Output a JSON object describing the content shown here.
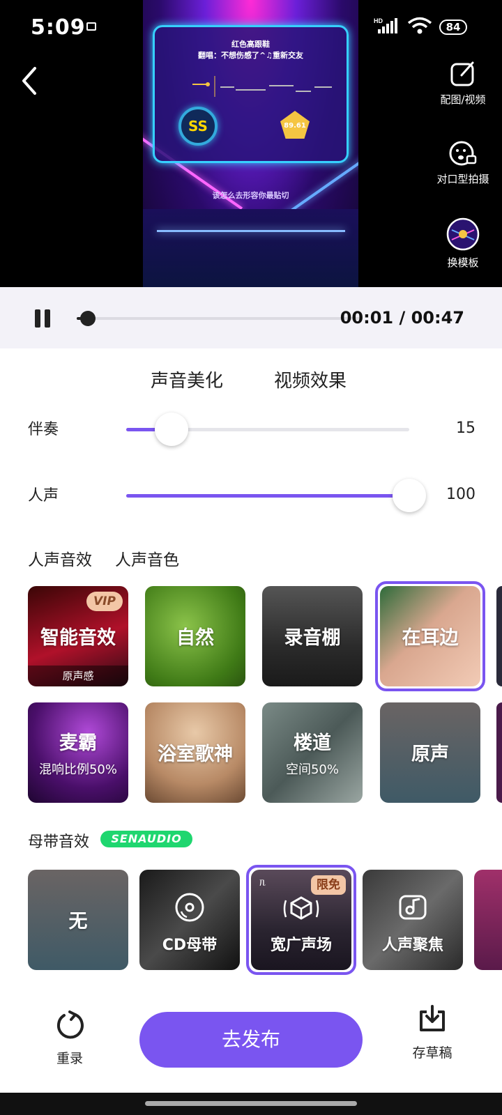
{
  "status": {
    "time": "5:09",
    "network": "HD",
    "battery": "84"
  },
  "video": {
    "song_title": "红色高跟鞋",
    "cover_line": "翻唱：不想伤感了^♫重新交友",
    "grade": "SS",
    "score": "89.61",
    "lyric": "该怎么去形容你最贴切"
  },
  "side_actions": [
    {
      "label": "配图/视频",
      "icon": "edit-square-icon"
    },
    {
      "label": "对口型拍摄",
      "icon": "lip-sync-camera-icon"
    },
    {
      "label": "换模板",
      "icon": "template-thumbnail-icon"
    }
  ],
  "player": {
    "current": "00:01",
    "total": "00:47",
    "progress": 0.04
  },
  "tabs": [
    {
      "label": "声音美化",
      "active": true
    },
    {
      "label": "视频效果",
      "active": false
    }
  ],
  "mix": {
    "accompaniment": {
      "label": "伴奏",
      "value": "15",
      "level": 0.16
    },
    "vocal": {
      "label": "人声",
      "value": "100",
      "level": 1.0
    }
  },
  "subtabs": [
    {
      "label": "人声音效",
      "active": true
    },
    {
      "label": "人声音色",
      "active": false
    }
  ],
  "vocal_effects_row1": [
    {
      "name": "智能音效",
      "badge": "VIP",
      "footer": "原声感"
    },
    {
      "name": "自然"
    },
    {
      "name": "录音棚"
    },
    {
      "name": "在耳边",
      "selected": true
    }
  ],
  "vocal_effects_row2": [
    {
      "name": "麦霸",
      "sub": "混响比例50%"
    },
    {
      "name": "浴室歌神"
    },
    {
      "name": "楼道",
      "sub": "空间50%"
    },
    {
      "name": "原声"
    }
  ],
  "master": {
    "label": "母带音效",
    "brand": "SENAUDIO",
    "items": [
      {
        "name": "无"
      },
      {
        "name": "CD母带",
        "icon": "disc-icon"
      },
      {
        "name": "宽广声场",
        "icon": "sound-field-icon",
        "badge": "限免",
        "selected": true
      },
      {
        "name": "人声聚焦",
        "icon": "mic-note-icon"
      }
    ]
  },
  "bottom": {
    "redo": "重录",
    "publish": "去发布",
    "draft": "存草稿"
  }
}
